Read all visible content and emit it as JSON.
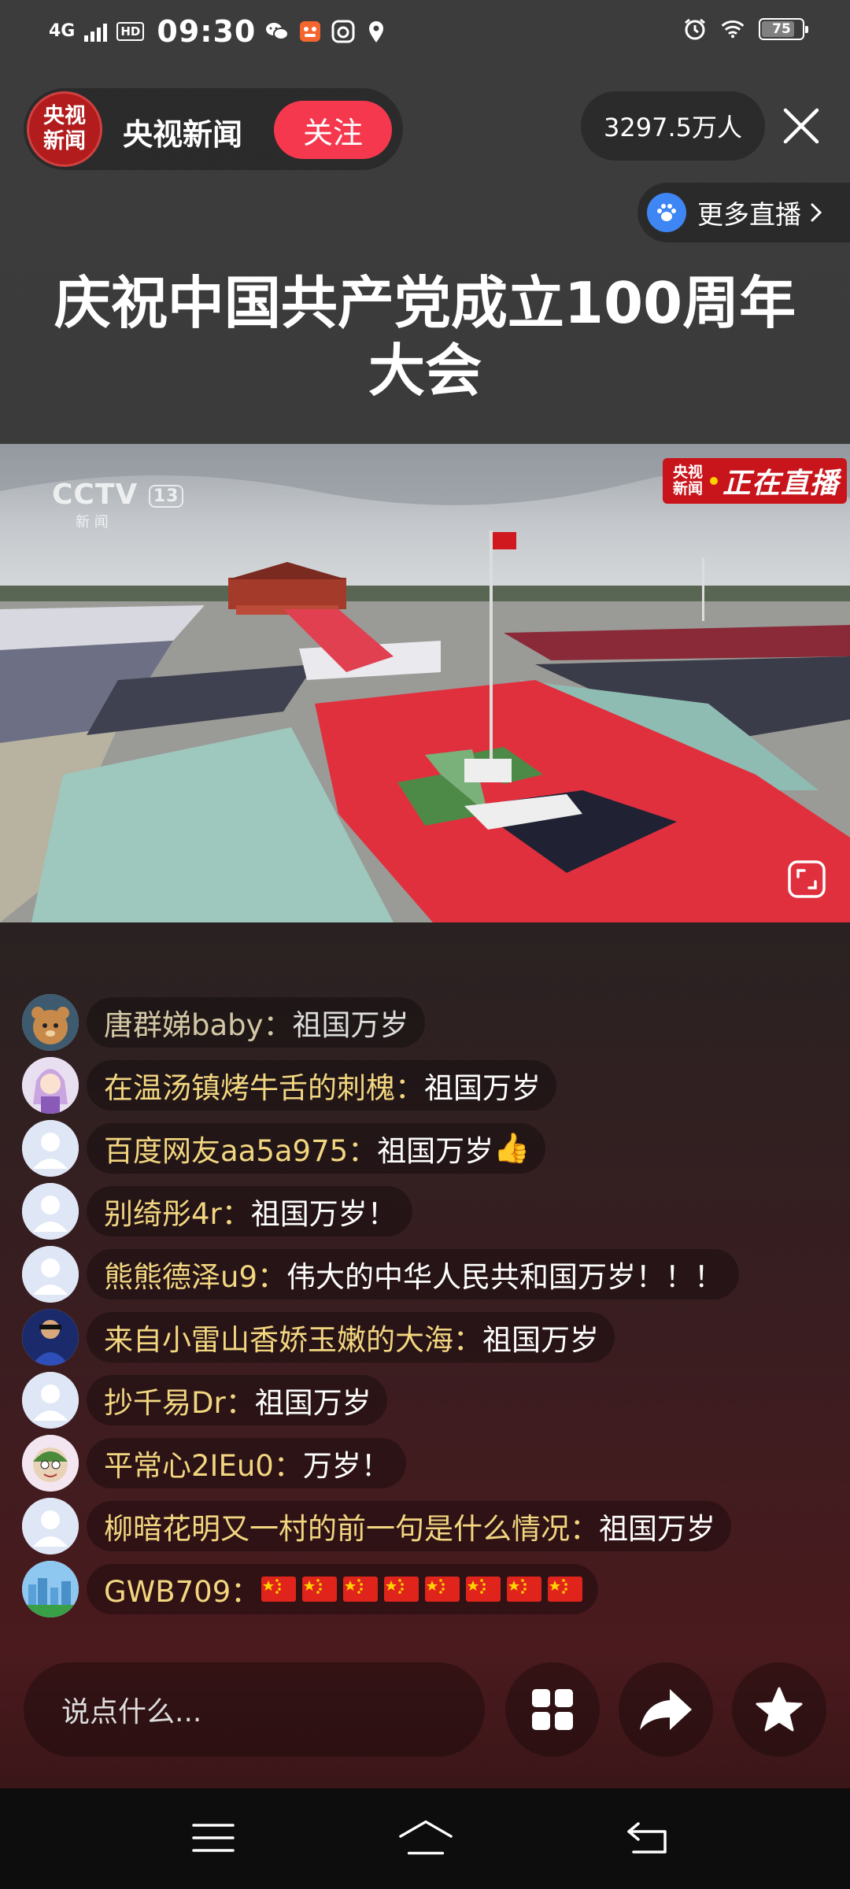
{
  "status_bar": {
    "network": "4G",
    "hd": "HD",
    "time": "09:30",
    "battery": "75",
    "battery_level": 0.75,
    "icons": [
      "signal-icon",
      "wechat-icon",
      "app-notification-icon",
      "baidu-icon",
      "location-icon",
      "alarm-icon",
      "wifi-icon",
      "battery-icon"
    ]
  },
  "header": {
    "channel_logo_line1": "央视",
    "channel_logo_line2": "新闻",
    "channel_name": "央视新闻",
    "follow_label": "关注",
    "viewers": "3297.5万人",
    "more_live_label": "更多直播"
  },
  "live_title": "庆祝中国共产党成立100周年大会",
  "video": {
    "watermark": "CCTV",
    "watermark_num": "13",
    "watermark_sub": "新 闻",
    "badge_logo_line1": "央视",
    "badge_logo_line2": "新闻",
    "badge_text": "正在直播"
  },
  "comments": [
    {
      "name": "唐群娣baby：",
      "text": "祖国万岁",
      "avatar": "bear"
    },
    {
      "name": "在温汤镇烤牛舌的刺槐：",
      "text": "祖国万岁",
      "avatar": "anime"
    },
    {
      "name": "百度网友aa5a975：",
      "text": "祖国万岁",
      "emoji": "👍",
      "avatar": "default"
    },
    {
      "name": "别绮彤4r：",
      "text": "祖国万岁！",
      "avatar": "default"
    },
    {
      "name": "熊熊德泽u9：",
      "text": "伟大的中华人民共和国万岁！！！",
      "avatar": "default"
    },
    {
      "name": "来自小雷山香娇玉嫩的大海：",
      "text": "祖国万岁",
      "avatar": "photo"
    },
    {
      "name": "抄千易Dr：",
      "text": "祖国万岁",
      "avatar": "default"
    },
    {
      "name": "平常心2IEu0：",
      "text": "万岁！",
      "avatar": "cartoon"
    },
    {
      "name": "柳暗花明又一村的前一句是什么情况：",
      "text": "祖国万岁",
      "avatar": "default"
    },
    {
      "name": "GWB709：",
      "text": "",
      "flags": 8,
      "avatar": "city"
    }
  ],
  "bottom": {
    "input_placeholder": "说点什么..."
  },
  "colors": {
    "follow": "#f5384e",
    "username": "#f2d680",
    "live_badge": "#c8151c",
    "channel_logo": "#b21c1c",
    "baidu_blue": "#3e86f3"
  }
}
